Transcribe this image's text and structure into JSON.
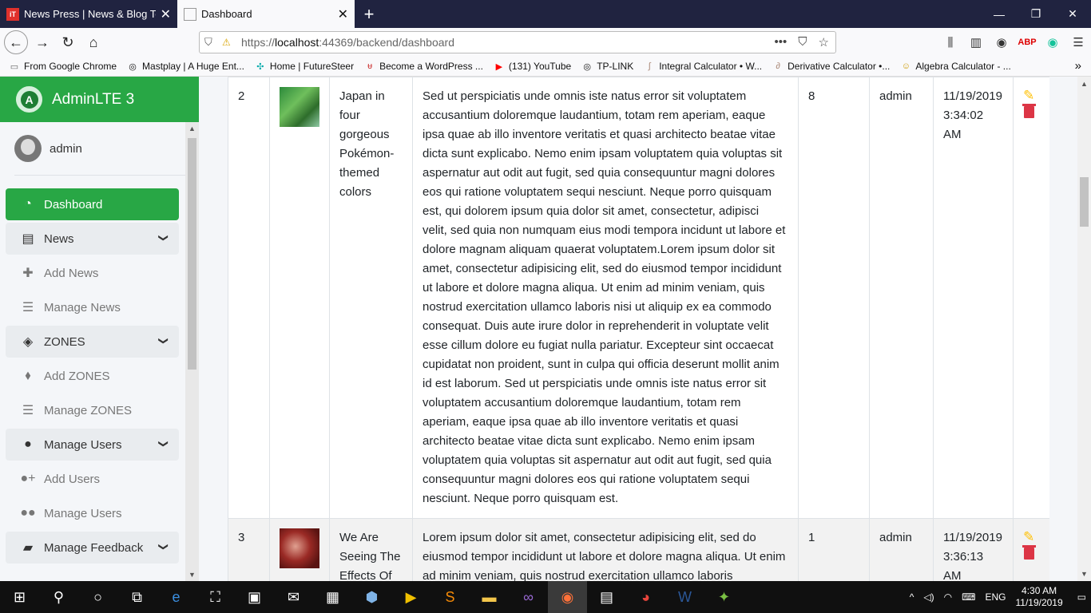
{
  "browser": {
    "tabs": [
      {
        "title": "News Press | News & Blog Temp",
        "active": false
      },
      {
        "title": "Dashboard",
        "active": true
      }
    ],
    "url_prefix": "https://",
    "url_host": "localhost",
    "url_rest": ":44369/backend/dashboard",
    "bookmarks": [
      "From Google Chrome",
      "Mastplay | A Huge Ent...",
      "Home | FutureSteer",
      "Become a WordPress ...",
      "(131) YouTube",
      "TP-LINK",
      "Integral Calculator • W...",
      "Derivative Calculator •...",
      "Algebra Calculator - ..."
    ]
  },
  "sidebar": {
    "brand": "AdminLTE 3",
    "user": "admin",
    "items": [
      {
        "label": "Dashboard",
        "icon": "tachometer-icon",
        "glyph": "◔",
        "kind": "active"
      },
      {
        "label": "News",
        "icon": "newspaper-icon",
        "glyph": "▤",
        "kind": "grp",
        "chevron": true
      },
      {
        "label": "Add News",
        "icon": "plus-icon",
        "glyph": "✚",
        "kind": "sub"
      },
      {
        "label": "Manage News",
        "icon": "list-icon",
        "glyph": "☰",
        "kind": "sub"
      },
      {
        "label": "ZONES",
        "icon": "layers-icon",
        "glyph": "◈",
        "kind": "grp",
        "chevron": true
      },
      {
        "label": "Add ZONES",
        "icon": "tags-icon",
        "glyph": "⬧",
        "kind": "sub"
      },
      {
        "label": "Manage ZONES",
        "icon": "list-icon",
        "glyph": "☰",
        "kind": "sub"
      },
      {
        "label": "Manage Users",
        "icon": "user-icon",
        "glyph": "●",
        "kind": "grp",
        "chevron": true
      },
      {
        "label": "Add Users",
        "icon": "user-plus-icon",
        "glyph": "●+",
        "kind": "sub"
      },
      {
        "label": "Manage Users",
        "icon": "users-icon",
        "glyph": "●●",
        "kind": "sub"
      },
      {
        "label": "Manage Feedback",
        "icon": "comment-icon",
        "glyph": "▰",
        "kind": "grp",
        "chevron": true
      }
    ]
  },
  "table": {
    "rows": [
      {
        "id": "2",
        "title": "Japan in four gorgeous Pokémon-themed colors",
        "description": "Sed ut perspiciatis unde omnis iste natus error sit voluptatem accusantium doloremque laudantium, totam rem aperiam, eaque ipsa quae ab illo inventore veritatis et quasi architecto beatae vitae dicta sunt explicabo. Nemo enim ipsam voluptatem quia voluptas sit aspernatur aut odit aut fugit, sed quia consequuntur magni dolores eos qui ratione voluptatem sequi nesciunt. Neque porro quisquam est, qui dolorem ipsum quia dolor sit amet, consectetur, adipisci velit, sed quia non numquam eius modi tempora incidunt ut labore et dolore magnam aliquam quaerat voluptatem.Lorem ipsum dolor sit amet, consectetur adipisicing elit, sed do eiusmod tempor incididunt ut labore et dolore magna aliqua. Ut enim ad minim veniam, quis nostrud exercitation ullamco laboris nisi ut aliquip ex ea commodo consequat. Duis aute irure dolor in reprehenderit in voluptate velit esse cillum dolore eu fugiat nulla pariatur. Excepteur sint occaecat cupidatat non proident, sunt in culpa qui officia deserunt mollit anim id est laborum. Sed ut perspiciatis unde omnis iste natus error sit voluptatem accusantium doloremque laudantium, totam rem aperiam, eaque ipsa quae ab illo inventore veritatis et quasi architecto beatae vitae dicta sunt explicabo. Nemo enim ipsam voluptatem quia voluptas sit aspernatur aut odit aut fugit, sed quia consequuntur magni dolores eos qui ratione voluptatem sequi nesciunt. Neque porro quisquam est.",
        "count": "8",
        "author": "admin",
        "date": "11/19/2019",
        "time": "3:34:02 AM"
      },
      {
        "id": "3",
        "title": "We Are Seeing The Effects Of",
        "description": "Lorem ipsum dolor sit amet, consectetur adipisicing elit, sed do eiusmod tempor incididunt ut labore et dolore magna aliqua. Ut enim ad minim veniam, quis nostrud exercitation ullamco laboris",
        "count": "1",
        "author": "admin",
        "date": "11/19/2019",
        "time": "3:36:13 AM"
      }
    ]
  },
  "taskbar": {
    "lang": "ENG",
    "time": "4:30 AM",
    "date": "11/19/2019"
  },
  "colors": {
    "brand": "#28a745",
    "edit": "#ffc107",
    "delete": "#dc3545"
  }
}
